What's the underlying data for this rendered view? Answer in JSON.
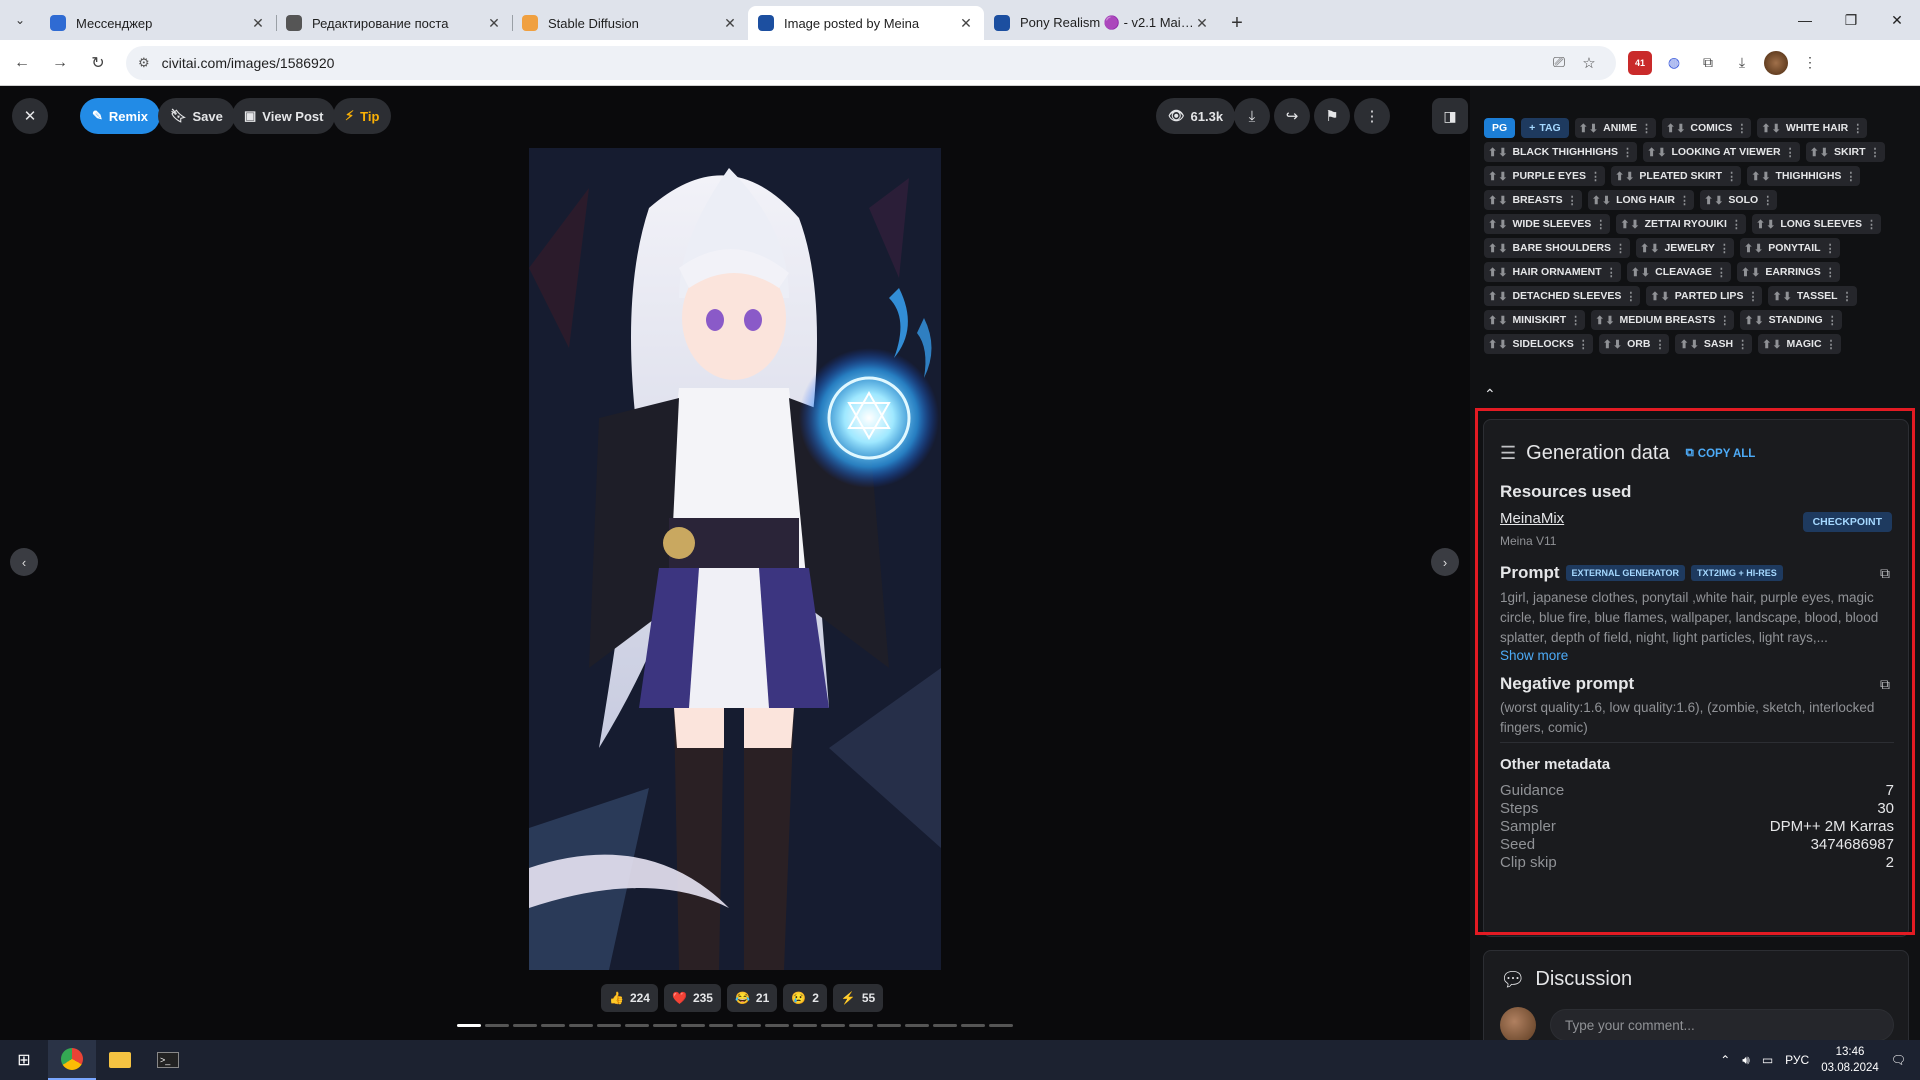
{
  "browser": {
    "tabs": [
      {
        "title": "Мессенджер",
        "icon_color": "#2f6bd3",
        "active": false
      },
      {
        "title": "Редактирование поста",
        "icon_color": "#555555",
        "active": false
      },
      {
        "title": "Stable Diffusion",
        "icon_color": "#f0a040",
        "active": false
      },
      {
        "title": "Image posted by Meina",
        "icon_color": "#1c4fa0",
        "active": true
      },
      {
        "title": "Pony Realism 🟣 - v2.1 Main -",
        "icon_color": "#1c4fa0",
        "active": false
      }
    ],
    "url": "civitai.com/images/1586920",
    "extension_badge": "41"
  },
  "viewer": {
    "remix_label": "Remix",
    "save_label": "Save",
    "view_post_label": "View Post",
    "tip_label": "Tip",
    "views": "61.3k",
    "reactions": [
      {
        "emoji": "👍",
        "count": "224"
      },
      {
        "emoji": "❤️",
        "count": "235"
      },
      {
        "emoji": "😂",
        "count": "21"
      },
      {
        "emoji": "😢",
        "count": "2"
      },
      {
        "emoji": "⚡",
        "count": "55"
      }
    ],
    "progress_segments": 20,
    "progress_active": 0
  },
  "tags": {
    "rating": "PG",
    "add_label": "TAG",
    "items": [
      "ANIME",
      "COMICS",
      "WHITE HAIR",
      "BLACK THIGHHIGHS",
      "LOOKING AT VIEWER",
      "SKIRT",
      "PURPLE EYES",
      "PLEATED SKIRT",
      "THIGHHIGHS",
      "BREASTS",
      "LONG HAIR",
      "SOLO",
      "WIDE SLEEVES",
      "ZETTAI RYOUIKI",
      "LONG SLEEVES",
      "BARE SHOULDERS",
      "JEWELRY",
      "PONYTAIL",
      "HAIR ORNAMENT",
      "CLEAVAGE",
      "EARRINGS",
      "DETACHED SLEEVES",
      "PARTED LIPS",
      "TASSEL",
      "MINISKIRT",
      "MEDIUM BREASTS",
      "STANDING",
      "SIDELOCKS",
      "ORB",
      "SASH",
      "MAGIC"
    ]
  },
  "generation": {
    "title": "Generation data",
    "copy_all": "COPY ALL",
    "resources_title": "Resources used",
    "resource_name": "MeinaMix",
    "resource_version": "Meina V11",
    "resource_type": "CHECKPOINT",
    "prompt_label": "Prompt",
    "prompt_badges": [
      "EXTERNAL GENERATOR",
      "TXT2IMG + HI-RES"
    ],
    "prompt_text": "1girl, japanese clothes, ponytail ,white hair, purple eyes, magic circle, blue fire, blue flames, wallpaper, landscape, blood, blood splatter, depth of field, night, light particles, light rays,...",
    "show_more": "Show more",
    "negative_label": "Negative prompt",
    "negative_text": "(worst quality:1.6, low quality:1.6), (zombie, sketch, interlocked fingers, comic)",
    "other_title": "Other metadata",
    "meta": [
      {
        "key": "Guidance",
        "value": "7"
      },
      {
        "key": "Steps",
        "value": "30"
      },
      {
        "key": "Sampler",
        "value": "DPM++ 2M Karras"
      },
      {
        "key": "Seed",
        "value": "3474686987"
      },
      {
        "key": "Clip skip",
        "value": "2"
      }
    ]
  },
  "discussion": {
    "title": "Discussion",
    "placeholder": "Type your comment..."
  },
  "taskbar": {
    "lang": "РУС",
    "time": "13:46",
    "date": "03.08.2024"
  }
}
